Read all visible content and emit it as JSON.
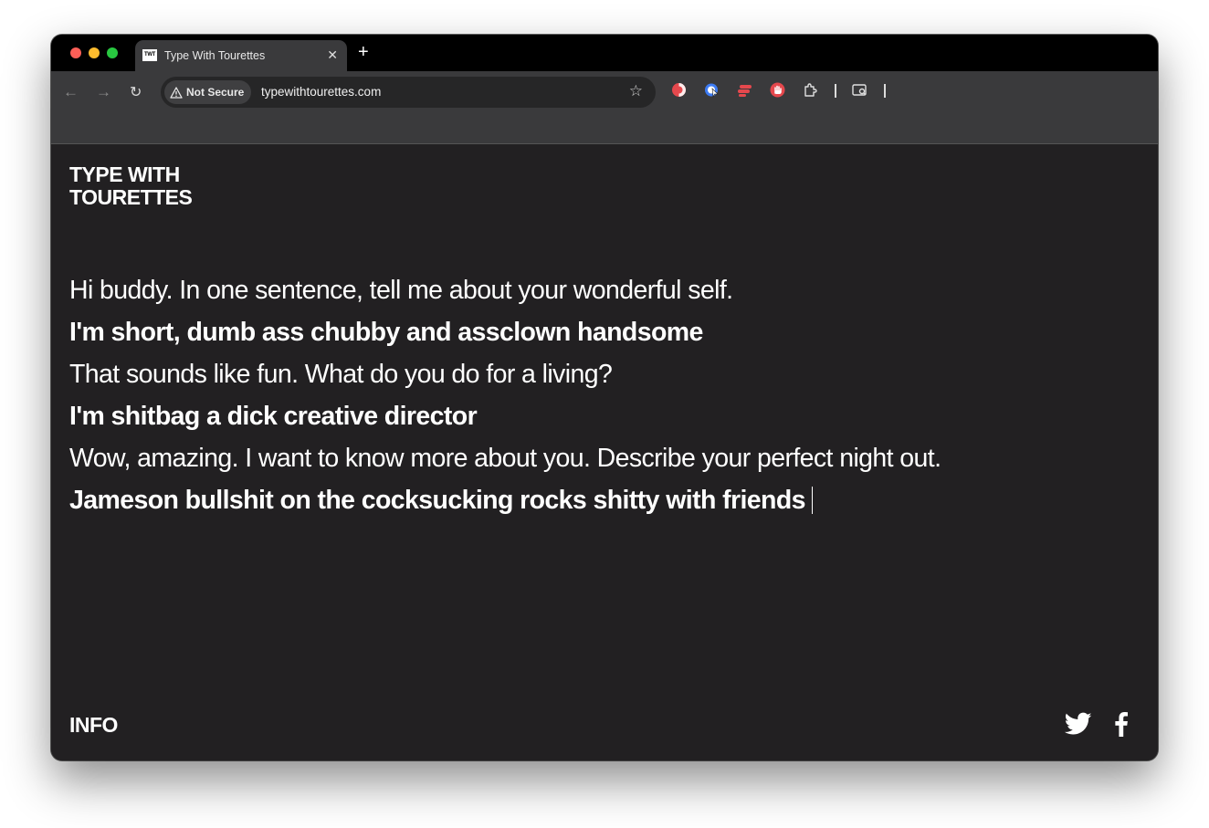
{
  "browser": {
    "tab": {
      "favicon_text": "TWT",
      "title": "Type With Tourettes",
      "close_glyph": "✕"
    },
    "new_tab_glyph": "+",
    "nav": {
      "back_glyph": "←",
      "forward_glyph": "→",
      "reload_glyph": "↻"
    },
    "omnibox": {
      "security_label": "Not Secure",
      "url": "typewithtourettes.com",
      "star_glyph": "☆"
    },
    "extensions": [
      "contrast-extension-icon",
      "mouse-extension-icon",
      "lastpass-extension-icon",
      "hand-extension-icon",
      "puzzle-extensions-icon",
      "tab-search-icon"
    ]
  },
  "page": {
    "logo_line1": "TYPE WITH",
    "logo_line2": "TOURETTES",
    "conversation": [
      {
        "role": "question",
        "text": "Hi buddy. In one sentence, tell me about your wonderful self."
      },
      {
        "role": "answer",
        "text": "I'm short, dumb ass chubby and assclown handsome"
      },
      {
        "role": "question",
        "text": "That sounds like fun. What do you do for a living?"
      },
      {
        "role": "answer",
        "text": "I'm shitbag a dick creative director"
      },
      {
        "role": "question",
        "text": "Wow, amazing. I want to know more about you. Describe your perfect night out."
      },
      {
        "role": "answer",
        "text": "Jameson bullshit on the cocksucking rocks shitty with friends"
      }
    ],
    "info_label": "INFO",
    "social": [
      "twitter-icon",
      "facebook-icon"
    ]
  },
  "colors": {
    "page_background": "#222022",
    "text": "#ffffff",
    "toolbar": "#3a3a3c",
    "tabstrip": "#000000"
  }
}
